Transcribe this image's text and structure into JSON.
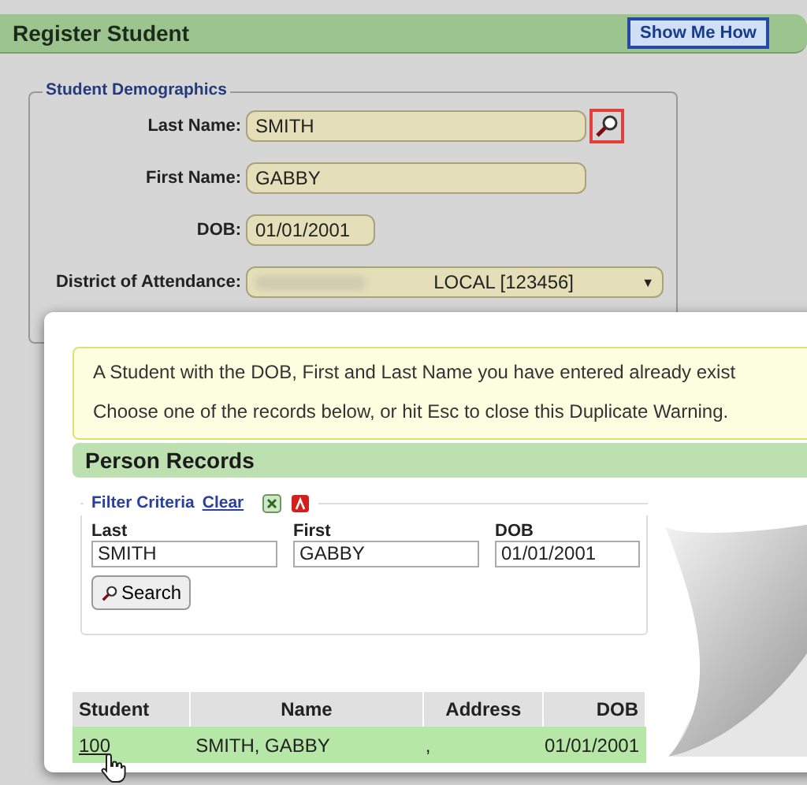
{
  "header": {
    "title": "Register Student",
    "help_button": "Show Me How"
  },
  "demographics": {
    "legend": "Student Demographics",
    "fields": [
      {
        "kind": "text",
        "label": "Last Name:",
        "value": "SMITH",
        "lookup": true
      },
      {
        "kind": "text",
        "label": "First Name:",
        "value": "GABBY",
        "lookup": false
      },
      {
        "kind": "date",
        "label": "DOB:",
        "value": "01/01/2001",
        "lookup": false
      },
      {
        "kind": "select",
        "label": "District of Attendance:",
        "value": "LOCAL [123456]",
        "caret": "▼",
        "lookup": false
      }
    ]
  },
  "duplicate_warning": {
    "lines": [
      "A Student with the DOB, First and Last Name you have entered already exist",
      "Choose one of the records below, or hit Esc to close this Duplicate Warning."
    ]
  },
  "person_records": {
    "title": "Person Records",
    "filter": {
      "legend": "Filter Criteria",
      "clear": "Clear",
      "inputs": [
        {
          "label": "Last",
          "value": "SMITH"
        },
        {
          "label": "First",
          "value": "GABBY"
        },
        {
          "label": "DOB",
          "value": "01/01/2001"
        }
      ],
      "search_button": "Search"
    },
    "table": {
      "columns": [
        "Student",
        "Name",
        "Address",
        "DOB"
      ],
      "rows": [
        {
          "cells": [
            "100",
            "SMITH, GABBY",
            ",",
            "01/01/2001"
          ],
          "selected": true
        }
      ]
    }
  }
}
